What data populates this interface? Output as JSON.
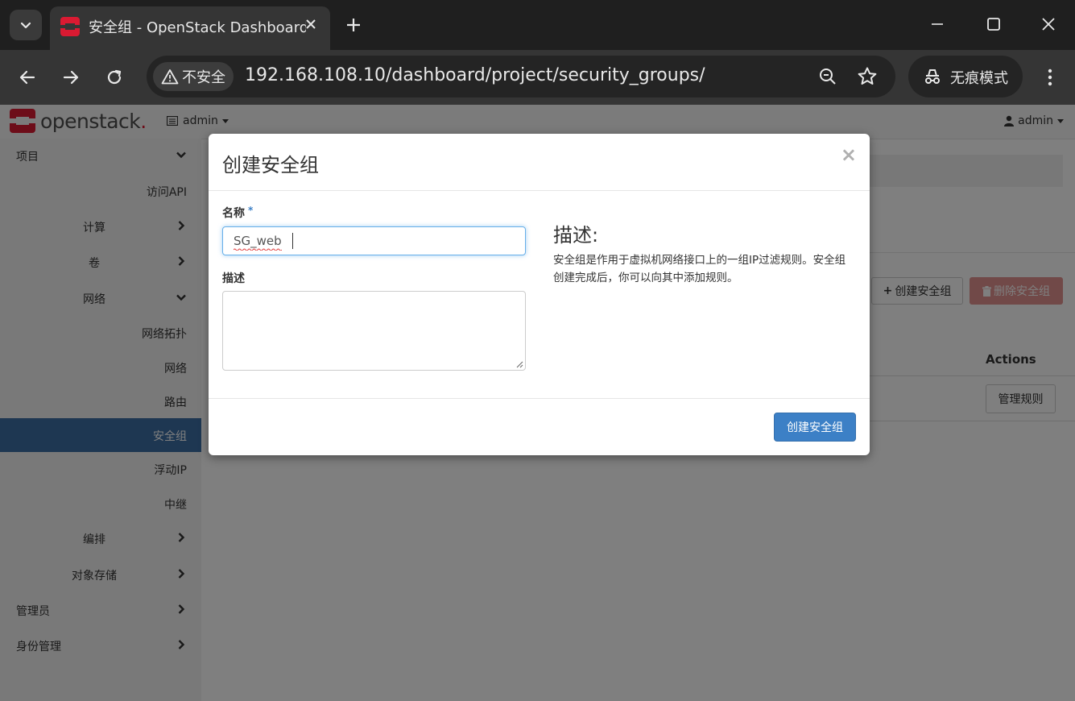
{
  "browser": {
    "tab_title": "安全组 - OpenStack Dashboard",
    "security_chip": "不安全",
    "url": "192.168.108.10/dashboard/project/security_groups/",
    "incognito_label": "无痕模式"
  },
  "header": {
    "logo_text": "openstack",
    "logo_dot": ".",
    "project": "admin",
    "user": "admin"
  },
  "sidebar": {
    "items": [
      {
        "label": "项目"
      },
      {
        "label": "访问API"
      },
      {
        "label": "计算"
      },
      {
        "label": "卷"
      },
      {
        "label": "网络"
      },
      {
        "label": "网络拓扑"
      },
      {
        "label": "网络"
      },
      {
        "label": "路由"
      },
      {
        "label": "安全组"
      },
      {
        "label": "浮动IP"
      },
      {
        "label": "中继"
      },
      {
        "label": "编排"
      },
      {
        "label": "对象存储"
      },
      {
        "label": "管理员"
      },
      {
        "label": "身份管理"
      }
    ]
  },
  "content": {
    "create_button": "创建安全组",
    "delete_button": "删除安全组",
    "actions_header": "Actions",
    "row_action": "管理规则"
  },
  "modal": {
    "title": "创建安全组",
    "close": "×",
    "name_label": "名称",
    "required_mark": "*",
    "name_value": "SG_web",
    "desc_label": "描述",
    "desc_value": "",
    "help_title": "描述:",
    "help_text": "安全组是作用于虚拟机网络接口上的一组IP过滤规则。安全组创建完成后，你可以向其中添加规则。",
    "submit_label": "创建安全组"
  },
  "colors": {
    "accent": "#3c80c6",
    "sidebar_active": "#3c6ea5",
    "danger_disabled": "#e39390",
    "openstack_red": "#da1a32"
  }
}
